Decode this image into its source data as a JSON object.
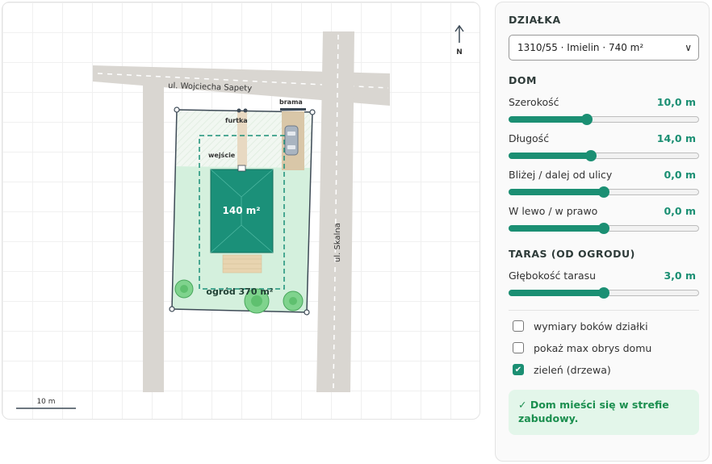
{
  "map": {
    "street_top": "ul. Wojciecha Sapety",
    "street_right": "ul. Skalna",
    "gate_label": "brama",
    "wicket_label": "furtka",
    "entrance_label": "wejście",
    "house_area_label": "140 m²",
    "garden_label": "ogród 370 m²",
    "north_label": "N",
    "scale_label": "10 m",
    "colors": {
      "road": "#d9d6d1",
      "plot_outline": "#3d4a56",
      "garden": "#d4f0dd",
      "house": "#1b9079",
      "tree": "#7fd38d",
      "terrace": "#e8d4b0",
      "driveway": "#d9c7a8",
      "car": "#a9b4c0"
    }
  },
  "panel": {
    "plot_section_title": "DZIAŁKA",
    "plot_select_value": "1310/55 · Imielin · 740 m²",
    "house_section_title": "DOM",
    "sliders": [
      {
        "label": "Szerokość",
        "value": "10,0 m",
        "fraction": 0.41
      },
      {
        "label": "Długość",
        "value": "14,0 m",
        "fraction": 0.43
      },
      {
        "label": "Bliżej / dalej od ulicy",
        "value": "0,0 m",
        "fraction": 0.5
      },
      {
        "label": "W lewo / w prawo",
        "value": "0,0 m",
        "fraction": 0.5
      }
    ],
    "terrace_section_title": "TARAS (OD OGRODU)",
    "terrace_slider": {
      "label": "Głębokość tarasu",
      "value": "3,0 m",
      "fraction": 0.5
    },
    "checkboxes": [
      {
        "label": "wymiary boków działki",
        "checked": false
      },
      {
        "label": "pokaż max obrys domu",
        "checked": false
      },
      {
        "label": "zieleń (drzewa)",
        "checked": true
      }
    ],
    "status_text": "✓ Dom mieści się w strefie zabudowy.",
    "accent_color": "#1b8f73"
  }
}
